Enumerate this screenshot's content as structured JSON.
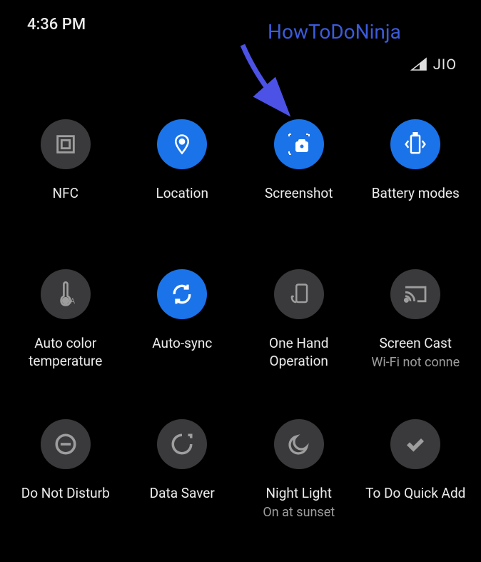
{
  "status": {
    "time": "4:36 PM",
    "carrier": "JIO"
  },
  "watermark": "HowToDoNinja",
  "tiles": [
    {
      "label": "NFC",
      "state": "off",
      "icon": "nfc"
    },
    {
      "label": "Location",
      "state": "on",
      "icon": "location"
    },
    {
      "label": "Screenshot",
      "state": "on",
      "icon": "screenshot"
    },
    {
      "label": "Battery modes",
      "state": "on",
      "icon": "battery"
    },
    {
      "label": "Auto color temperature",
      "state": "off",
      "icon": "thermometer"
    },
    {
      "label": "Auto-sync",
      "state": "on",
      "icon": "sync"
    },
    {
      "label": "One Hand Operation",
      "state": "off",
      "icon": "onehand"
    },
    {
      "label": "Screen Cast",
      "sublabel": "Wi-Fi not conne",
      "state": "off",
      "icon": "cast"
    },
    {
      "label": "Do Not Disturb",
      "state": "off",
      "icon": "dnd"
    },
    {
      "label": "Data Saver",
      "state": "off",
      "icon": "datasaver"
    },
    {
      "label": "Night Light",
      "sublabel": "On at sunset",
      "state": "off",
      "icon": "moon"
    },
    {
      "label": "To Do Quick Add",
      "state": "off",
      "icon": "check"
    }
  ]
}
